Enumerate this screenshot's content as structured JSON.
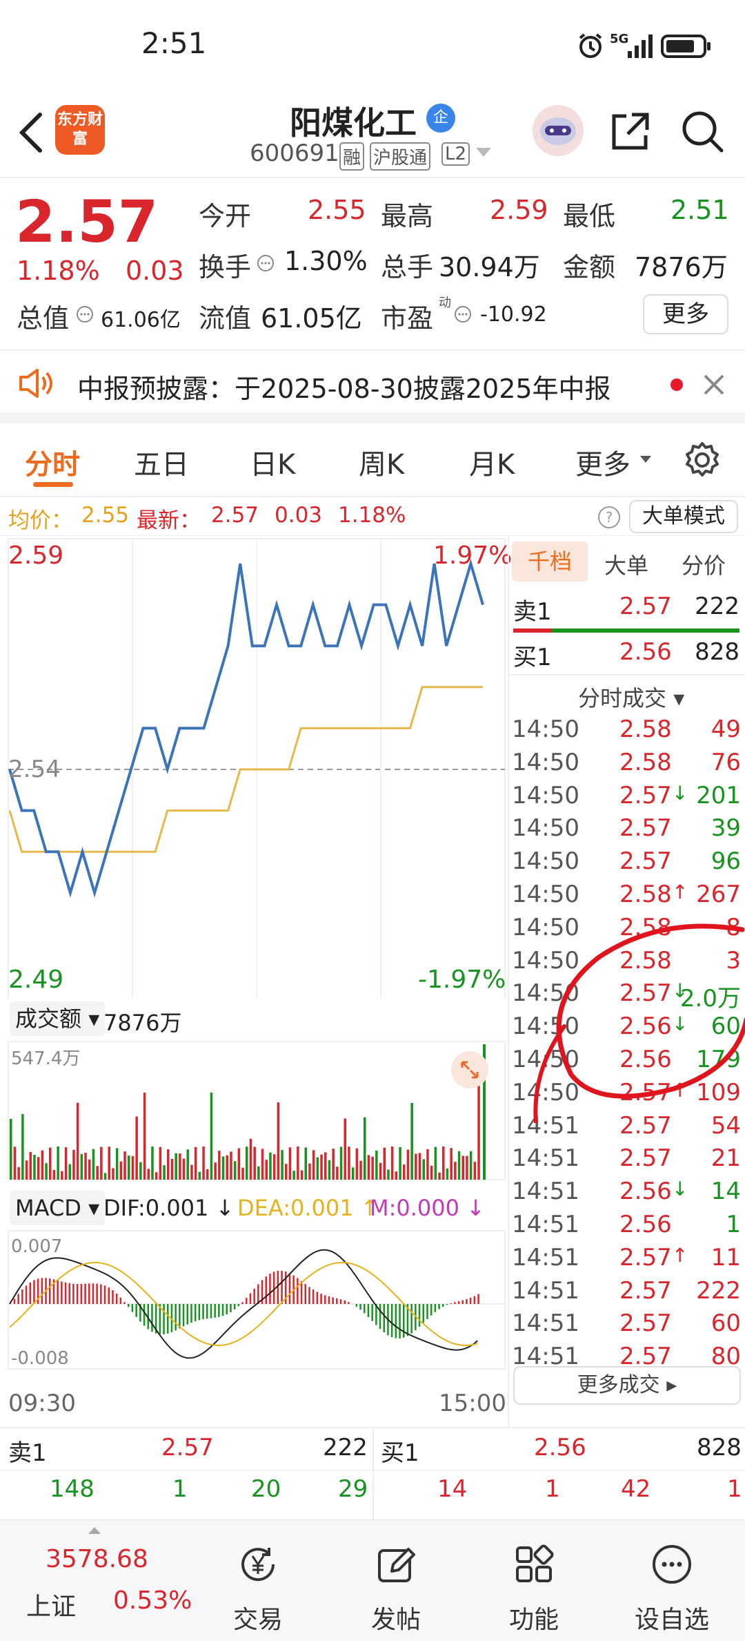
{
  "status_bar": {
    "time": "2:51",
    "network": "5G"
  },
  "header": {
    "stock_name": "阳煤化工",
    "company_badge": "企",
    "code": "600691",
    "tags": [
      "融",
      "沪股通",
      "L2"
    ],
    "logo_text": "东方财富"
  },
  "quote": {
    "price": "2.57",
    "change_pct": "1.18%",
    "change": "0.03",
    "fields": {
      "open_label": "今开",
      "open": "2.55",
      "high_label": "最高",
      "high": "2.59",
      "low_label": "最低",
      "low": "2.51",
      "turnover_label": "换手",
      "turnover": "1.30%",
      "volume_label": "总手",
      "volume": "30.94万",
      "amount_label": "金额",
      "amount": "7876万",
      "mcap_label": "总值",
      "mcap": "61.06亿",
      "float_label": "流值",
      "float": "61.05亿",
      "pe_label": "市盈",
      "pe_sup": "动",
      "pe": "-10.92"
    },
    "more_button": "更多"
  },
  "notice": {
    "text": "中报预披露：于2025-08-30披露2025年中报"
  },
  "tabs": {
    "items": [
      "分时",
      "五日",
      "日K",
      "周K",
      "月K",
      "更多"
    ],
    "active": "分时"
  },
  "info_bar": {
    "avg_label": "均价：",
    "avg": "2.55",
    "latest_label": "最新：",
    "latest": "2.57",
    "change": "0.03",
    "change_pct": "1.18%",
    "big_order_mode": "大单模式"
  },
  "chart_labels": {
    "price_high": "2.59",
    "price_mid": "2.54",
    "price_low": "2.49",
    "pct_high": "1.97%",
    "pct_low": "-1.97%",
    "volume_selector": "成交额",
    "volume_total": "7876万",
    "volume_max": "547.4万",
    "macd_selector": "MACD",
    "dif": "DIF:0.001",
    "dea": "DEA:0.001",
    "m": "M:0.000",
    "macd_top": "0.007",
    "macd_bottom": "-0.008",
    "time_start": "09:30",
    "time_end": "15:00"
  },
  "chart_data": {
    "type": "line",
    "title": "",
    "xlabel": "",
    "ylabel": "",
    "ylim": [
      2.49,
      2.59
    ],
    "x_range": [
      "09:30",
      "15:00"
    ],
    "series": [
      {
        "name": "",
        "values": [
          2.54,
          2.53,
          2.53,
          2.52,
          2.52,
          2.51,
          2.52,
          2.51,
          2.52,
          2.53,
          2.54,
          2.55,
          2.55,
          2.54,
          2.55,
          2.55,
          2.55,
          2.56,
          2.57,
          2.59,
          2.57,
          2.57,
          2.58,
          2.57,
          2.57,
          2.58,
          2.57,
          2.57,
          2.58,
          2.57,
          2.58,
          2.58,
          2.57,
          2.58,
          2.57,
          2.59,
          2.57,
          2.58,
          2.59,
          2.58
        ]
      },
      {
        "name": "",
        "values": [
          2.53,
          2.52,
          2.52,
          2.52,
          2.52,
          2.52,
          2.52,
          2.52,
          2.52,
          2.52,
          2.52,
          2.52,
          2.52,
          2.53,
          2.53,
          2.53,
          2.53,
          2.53,
          2.53,
          2.54,
          2.54,
          2.54,
          2.54,
          2.54,
          2.55,
          2.55,
          2.55,
          2.55,
          2.55,
          2.55,
          2.55,
          2.55,
          2.55,
          2.55,
          2.56,
          2.56,
          2.56,
          2.56,
          2.56,
          2.56
        ]
      }
    ],
    "colors": {
      "price": "#3b74b8",
      "avg": "#e8b74a",
      "mid_line": "#999999"
    }
  },
  "order_book": {
    "tabs": [
      "千档",
      "大单",
      "分价"
    ],
    "sell_label": "卖1",
    "sell_price": "2.57",
    "sell_qty": "222",
    "buy_label": "买1",
    "buy_price": "2.56",
    "buy_qty": "828",
    "ticks_title": "分时成交",
    "more_ticks": "更多成交",
    "ticks": [
      {
        "time": "14:50",
        "price": "2.58",
        "arrow": "",
        "qty": "49",
        "color": "red"
      },
      {
        "time": "14:50",
        "price": "2.58",
        "arrow": "",
        "qty": "76",
        "color": "red"
      },
      {
        "time": "14:50",
        "price": "2.57",
        "arrow": "↓",
        "qty": "201",
        "color": "green"
      },
      {
        "time": "14:50",
        "price": "2.57",
        "arrow": "",
        "qty": "39",
        "color": "green"
      },
      {
        "time": "14:50",
        "price": "2.57",
        "arrow": "",
        "qty": "96",
        "color": "green"
      },
      {
        "time": "14:50",
        "price": "2.58",
        "arrow": "↑",
        "qty": "267",
        "color": "red"
      },
      {
        "time": "14:50",
        "price": "2.58",
        "arrow": "",
        "qty": "8",
        "color": "red"
      },
      {
        "time": "14:50",
        "price": "2.58",
        "arrow": "",
        "qty": "3",
        "color": "red"
      },
      {
        "time": "14:50",
        "price": "2.57",
        "arrow": "↓",
        "qty": "2.0万",
        "color": "green"
      },
      {
        "time": "14:50",
        "price": "2.56",
        "arrow": "↓",
        "qty": "60",
        "color": "green"
      },
      {
        "time": "14:50",
        "price": "2.56",
        "arrow": "",
        "qty": "179",
        "color": "green"
      },
      {
        "time": "14:50",
        "price": "2.57",
        "arrow": "↑",
        "qty": "109",
        "color": "red"
      },
      {
        "time": "14:51",
        "price": "2.57",
        "arrow": "",
        "qty": "54",
        "color": "red"
      },
      {
        "time": "14:51",
        "price": "2.57",
        "arrow": "",
        "qty": "21",
        "color": "red"
      },
      {
        "time": "14:51",
        "price": "2.56",
        "arrow": "↓",
        "qty": "14",
        "color": "green"
      },
      {
        "time": "14:51",
        "price": "2.56",
        "arrow": "",
        "qty": "1",
        "color": "green"
      },
      {
        "time": "14:51",
        "price": "2.57",
        "arrow": "↑",
        "qty": "11",
        "color": "red"
      },
      {
        "time": "14:51",
        "price": "2.57",
        "arrow": "",
        "qty": "222",
        "color": "red"
      },
      {
        "time": "14:51",
        "price": "2.57",
        "arrow": "",
        "qty": "60",
        "color": "red"
      },
      {
        "time": "14:51",
        "price": "2.57",
        "arrow": "",
        "qty": "80",
        "color": "red"
      }
    ]
  },
  "bottom_book": {
    "sell_label": "卖1",
    "sell_price": "2.57",
    "sell_qty": "222",
    "buy_label": "买1",
    "buy_price": "2.56",
    "buy_qty": "828",
    "sell_details": [
      "148",
      "1",
      "20",
      "29"
    ],
    "buy_details": [
      "14",
      "1",
      "42",
      "1"
    ]
  },
  "bottom_nav": {
    "index_value": "3578.68",
    "index_name": "上证",
    "index_pct": "0.53%",
    "items": [
      "交易",
      "发帖",
      "功能",
      "设自选"
    ]
  }
}
